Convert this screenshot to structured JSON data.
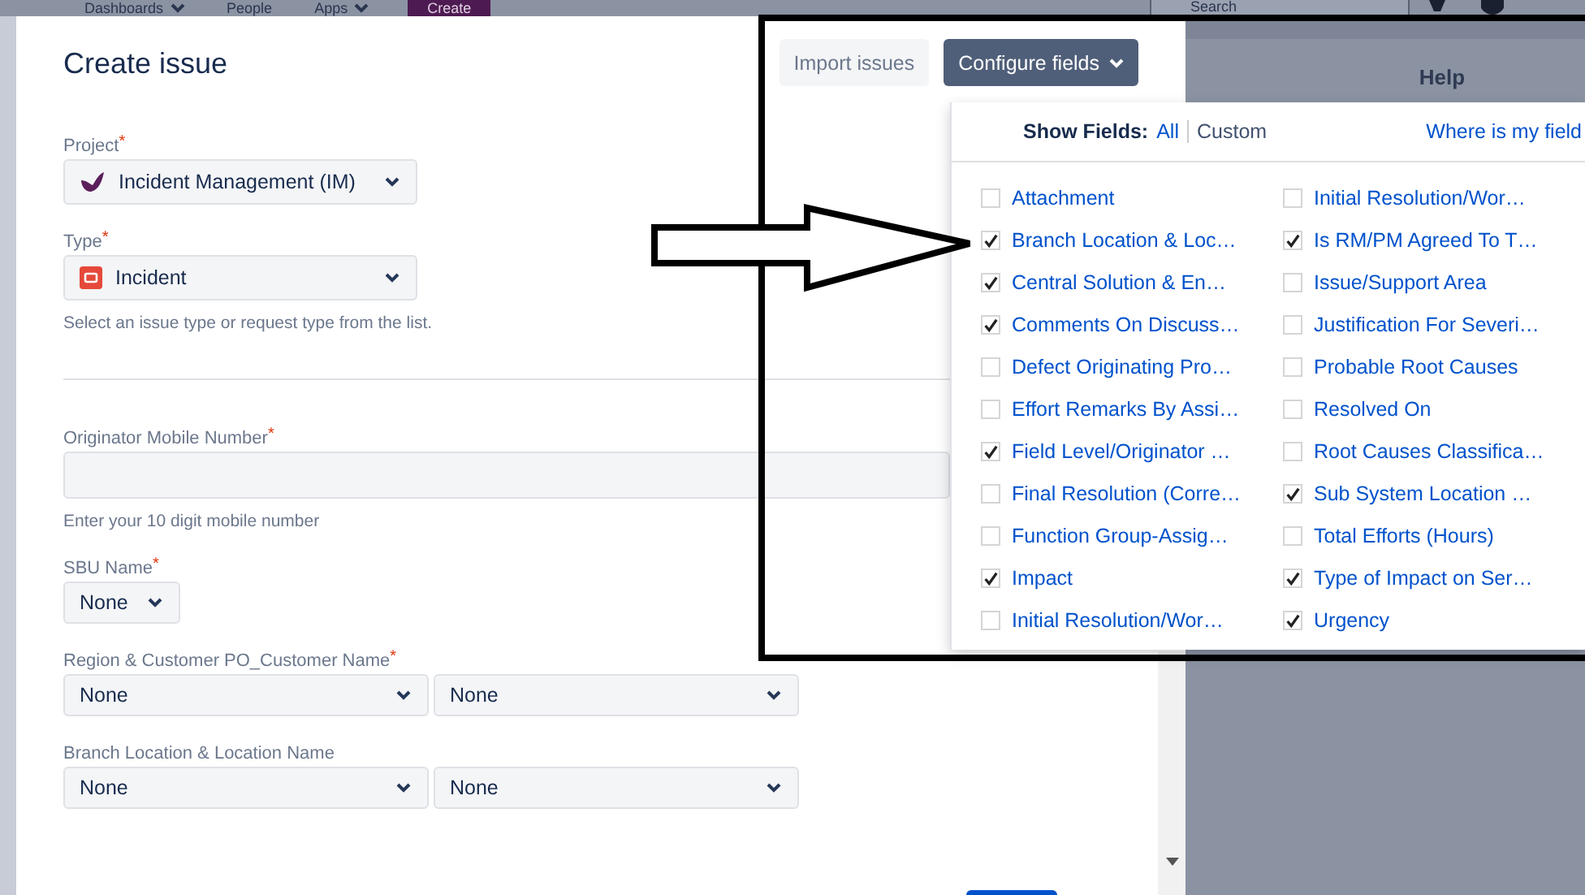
{
  "nav": {
    "items": [
      {
        "label": "Dashboards",
        "has_menu": true
      },
      {
        "label": "People",
        "has_menu": false
      },
      {
        "label": "Apps",
        "has_menu": true
      }
    ],
    "create_button": "Create",
    "search": {
      "placeholder": "Search"
    }
  },
  "dialog": {
    "title": "Create issue",
    "import_button": "Import issues",
    "configure_button": "Configure fields",
    "fields": [
      {
        "kind": "select",
        "label": "Project",
        "required_mark": "*",
        "selects": [
          {
            "value": "Incident Management (IM)"
          }
        ]
      },
      {
        "kind": "select",
        "label": "Type",
        "required_mark": "*",
        "selects": [
          {
            "value": "Incident"
          }
        ],
        "help": "Select an issue type or request type from the list."
      },
      {
        "kind": "divider"
      },
      {
        "kind": "text",
        "label": "Originator Mobile Number",
        "required_mark": "*",
        "help": "Enter your 10 digit mobile number"
      },
      {
        "kind": "select",
        "label": "SBU Name",
        "required_mark": "*",
        "selects": [
          {
            "value": "None"
          }
        ]
      },
      {
        "kind": "select",
        "label": "Region & Customer PO_Customer Name",
        "required_mark": "*",
        "selects": [
          {
            "value": "None"
          },
          {
            "value": "None"
          }
        ]
      },
      {
        "kind": "select",
        "label": "Branch Location & Location Name",
        "selects": [
          {
            "value": "None"
          },
          {
            "value": "None"
          }
        ]
      }
    ]
  },
  "field_config": {
    "show_fields_label": "Show Fields:",
    "options": [
      {
        "label": "All",
        "selected": false
      },
      {
        "label": "Custom",
        "selected": true
      }
    ],
    "help_link": "Where is my field",
    "columns": [
      [
        {
          "label": "Attachment",
          "checked": false
        },
        {
          "label": "Branch Location & Loc…",
          "checked": true
        },
        {
          "label": "Central Solution & En…",
          "checked": true
        },
        {
          "label": "Comments On Discuss…",
          "checked": true
        },
        {
          "label": "Defect Originating Pro…",
          "checked": false
        },
        {
          "label": "Effort Remarks By Assi…",
          "checked": false
        },
        {
          "label": "Field Level/Originator …",
          "checked": true
        },
        {
          "label": "Final Resolution (Corre…",
          "checked": false
        },
        {
          "label": "Function Group-Assig…",
          "checked": false
        },
        {
          "label": "Impact",
          "checked": true
        },
        {
          "label": "Initial Resolution/Wor…",
          "checked": false
        }
      ],
      [
        {
          "label": "Initial Resolution/Wor…",
          "checked": false
        },
        {
          "label": "Is RM/PM Agreed To T…",
          "checked": true
        },
        {
          "label": "Issue/Support Area",
          "checked": false
        },
        {
          "label": "Justification For Severi…",
          "checked": false
        },
        {
          "label": "Probable Root Causes",
          "checked": false
        },
        {
          "label": "Resolved On",
          "checked": false
        },
        {
          "label": "Root Causes Classifica…",
          "checked": false
        },
        {
          "label": "Sub System Location …",
          "checked": true
        },
        {
          "label": "Total Efforts (Hours)",
          "checked": false
        },
        {
          "label": "Type of Impact on Ser…",
          "checked": true
        },
        {
          "label": "Urgency",
          "checked": true
        }
      ]
    ]
  },
  "help_panel": {
    "title": "Help"
  }
}
